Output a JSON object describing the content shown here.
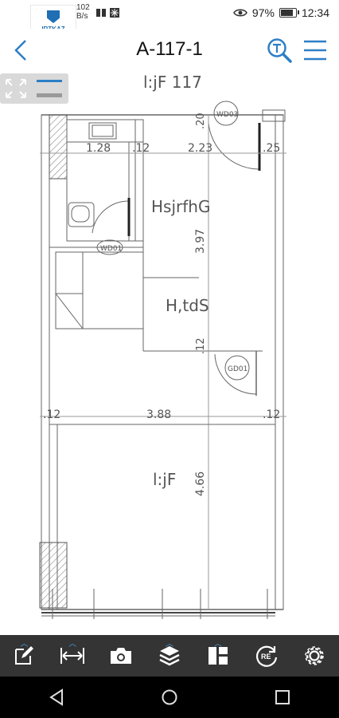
{
  "status_bar": {
    "network_speed": "102",
    "network_unit": "B/s",
    "battery": "97%",
    "time": "12:34",
    "logo_text": "IRTKAZ"
  },
  "app_bar": {
    "title": "A-117-1"
  },
  "plan": {
    "labels": {
      "room_top": "l:jF  117",
      "room_a": "HsjrfhG",
      "room_b": "H,tdS",
      "room_c": "l:jF",
      "wd03": "WD03",
      "wd01": "WD01",
      "gd01": "GD01"
    },
    "dims": {
      "d128": "1.28",
      "d12a": ".12",
      "d223": "2.23",
      "d25": ".25",
      "d20": ".20",
      "d397": "3.97",
      "d12b": ".12",
      "d12c": ".12",
      "d388": "3.88",
      "d12d": ".12",
      "d466": "4.66"
    }
  },
  "toolbar": {
    "items": [
      "edit",
      "measure",
      "camera",
      "layers",
      "layout",
      "re",
      "settings"
    ],
    "re_label": "RE"
  },
  "colors": {
    "accent": "#1e6fb3",
    "toolbar_bg": "#343434",
    "caret": "#4aa3e0"
  }
}
